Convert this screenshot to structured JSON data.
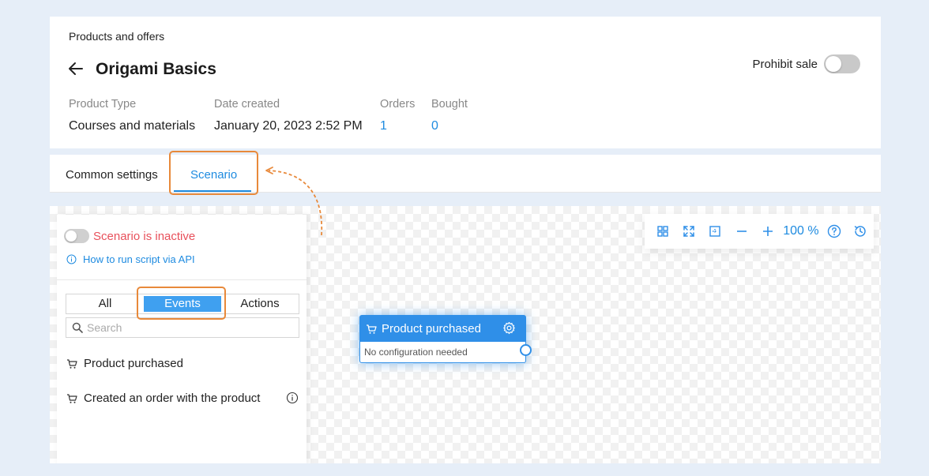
{
  "header": {
    "breadcrumb": "Products and offers",
    "title": "Origami Basics",
    "prohibit_sale_label": "Prohibit sale",
    "meta": {
      "product_type_label": "Product Type",
      "product_type_value": "Courses and materials",
      "date_created_label": "Date created",
      "date_created_value": "January 20, 2023 2:52 PM",
      "orders_label": "Orders",
      "orders_value": "1",
      "bought_label": "Bought",
      "bought_value": "0"
    }
  },
  "tabs": [
    {
      "label": "Common settings",
      "active": false
    },
    {
      "label": "Scenario",
      "active": true
    }
  ],
  "panel": {
    "status_text": "Scenario is inactive",
    "api_link": "How to run script via API",
    "segments": [
      "All",
      "Events",
      "Actions"
    ],
    "selected_segment": "Events",
    "search_placeholder": "Search",
    "events": [
      {
        "label": "Product purchased",
        "icon": "cart-icon",
        "info": false
      },
      {
        "label": "Created an order with the product",
        "icon": "cart-icon",
        "info": true
      }
    ]
  },
  "toolbar": {
    "icons": [
      "grid-icon",
      "fullscreen-icon",
      "fit-icon",
      "zoom-out-icon",
      "zoom-in-icon"
    ],
    "zoom": "100 %",
    "trailing_icons": [
      "help-icon",
      "history-icon"
    ]
  },
  "node": {
    "title": "Product purchased",
    "body": "No configuration needed"
  },
  "colors": {
    "accent": "#1e8be0",
    "highlight": "#e8893a",
    "inactive": "#e8505b",
    "node": "#2f8fe8"
  }
}
